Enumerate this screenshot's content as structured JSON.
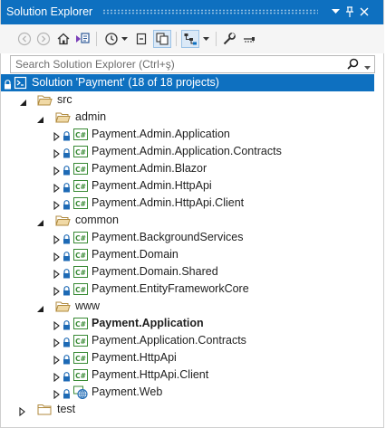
{
  "panel": {
    "title": "Solution Explorer",
    "controls": {
      "menu": "▾",
      "pin": "📌",
      "close": "✕"
    }
  },
  "toolbar": {
    "buttons": [
      "back-icon",
      "forward-icon",
      "home-icon",
      "switch-views-icon",
      "history-icon",
      "collapse-all-icon",
      "show-all-files-icon",
      "preview-selected-icon",
      "properties-icon",
      "wrench-icon"
    ]
  },
  "search": {
    "placeholder": "Search Solution Explorer (Ctrl+ş)"
  },
  "tree": {
    "solution": "Solution 'Payment' (18 of 18 projects)",
    "src": "src",
    "admin": {
      "label": "admin",
      "projects": [
        "Payment.Admin.Application",
        "Payment.Admin.Application.Contracts",
        "Payment.Admin.Blazor",
        "Payment.Admin.HttpApi",
        "Payment.Admin.HttpApi.Client"
      ]
    },
    "common": {
      "label": "common",
      "projects": [
        "Payment.BackgroundServices",
        "Payment.Domain",
        "Payment.Domain.Shared",
        "Payment.EntityFrameworkCore"
      ]
    },
    "www": {
      "label": "www",
      "projects": [
        "Payment.Application",
        "Payment.Application.Contracts",
        "Payment.HttpApi",
        "Payment.HttpApi.Client",
        "Payment.Web"
      ]
    },
    "test": "test"
  },
  "colors": {
    "accent": "#0e70c0",
    "folder": "#dcb67a",
    "csproj": "#388a34",
    "lock": "#1e6ab5"
  }
}
